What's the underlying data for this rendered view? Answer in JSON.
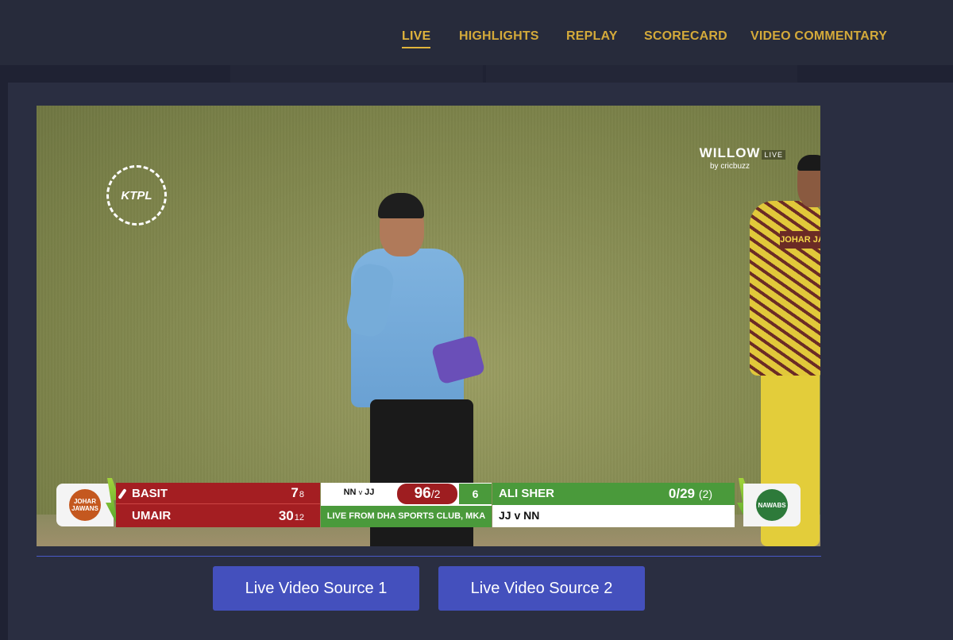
{
  "nav": {
    "items": [
      {
        "label": "LIVE",
        "active": true
      },
      {
        "label": "HIGHLIGHTS"
      },
      {
        "label": "REPLAY"
      },
      {
        "label": "SCORECARD"
      },
      {
        "label": "VIDEO COMMENTARY"
      }
    ]
  },
  "video": {
    "tournament_logo": "KTPL",
    "broadcaster": "WILLOW",
    "broadcaster_tag": "LIVE",
    "broadcaster_by": "by cricbuzz",
    "keeper_shirt": "JOHAR JA",
    "scoreboard": {
      "left_team_logo": "JOHAR JAWANS",
      "right_team_logo": "NAWABS",
      "batters": [
        {
          "name": "BASIT",
          "runs": "7",
          "balls": "8",
          "on_strike": true
        },
        {
          "name": "UMAIR",
          "runs": "30",
          "balls": "12",
          "on_strike": false
        }
      ],
      "matchup_a": "NN",
      "matchup_v": "v",
      "matchup_b": "JJ",
      "total": "96",
      "wickets": "/2",
      "overs": "6",
      "venue": "LIVE FROM DHA SPORTS CLUB, MKA",
      "bowler": {
        "name": "ALI SHER",
        "figures": "0/29",
        "overs": "(2)"
      },
      "fixture": "JJ v NN"
    }
  },
  "sources": {
    "source1": "Live Video Source 1",
    "source2": "Live Video Source 2"
  },
  "colors": {
    "nav_text": "#d4aa3a",
    "button_bg": "#4450bd",
    "batting_red": "#a41e22",
    "bowling_green": "#4a9a3b"
  }
}
